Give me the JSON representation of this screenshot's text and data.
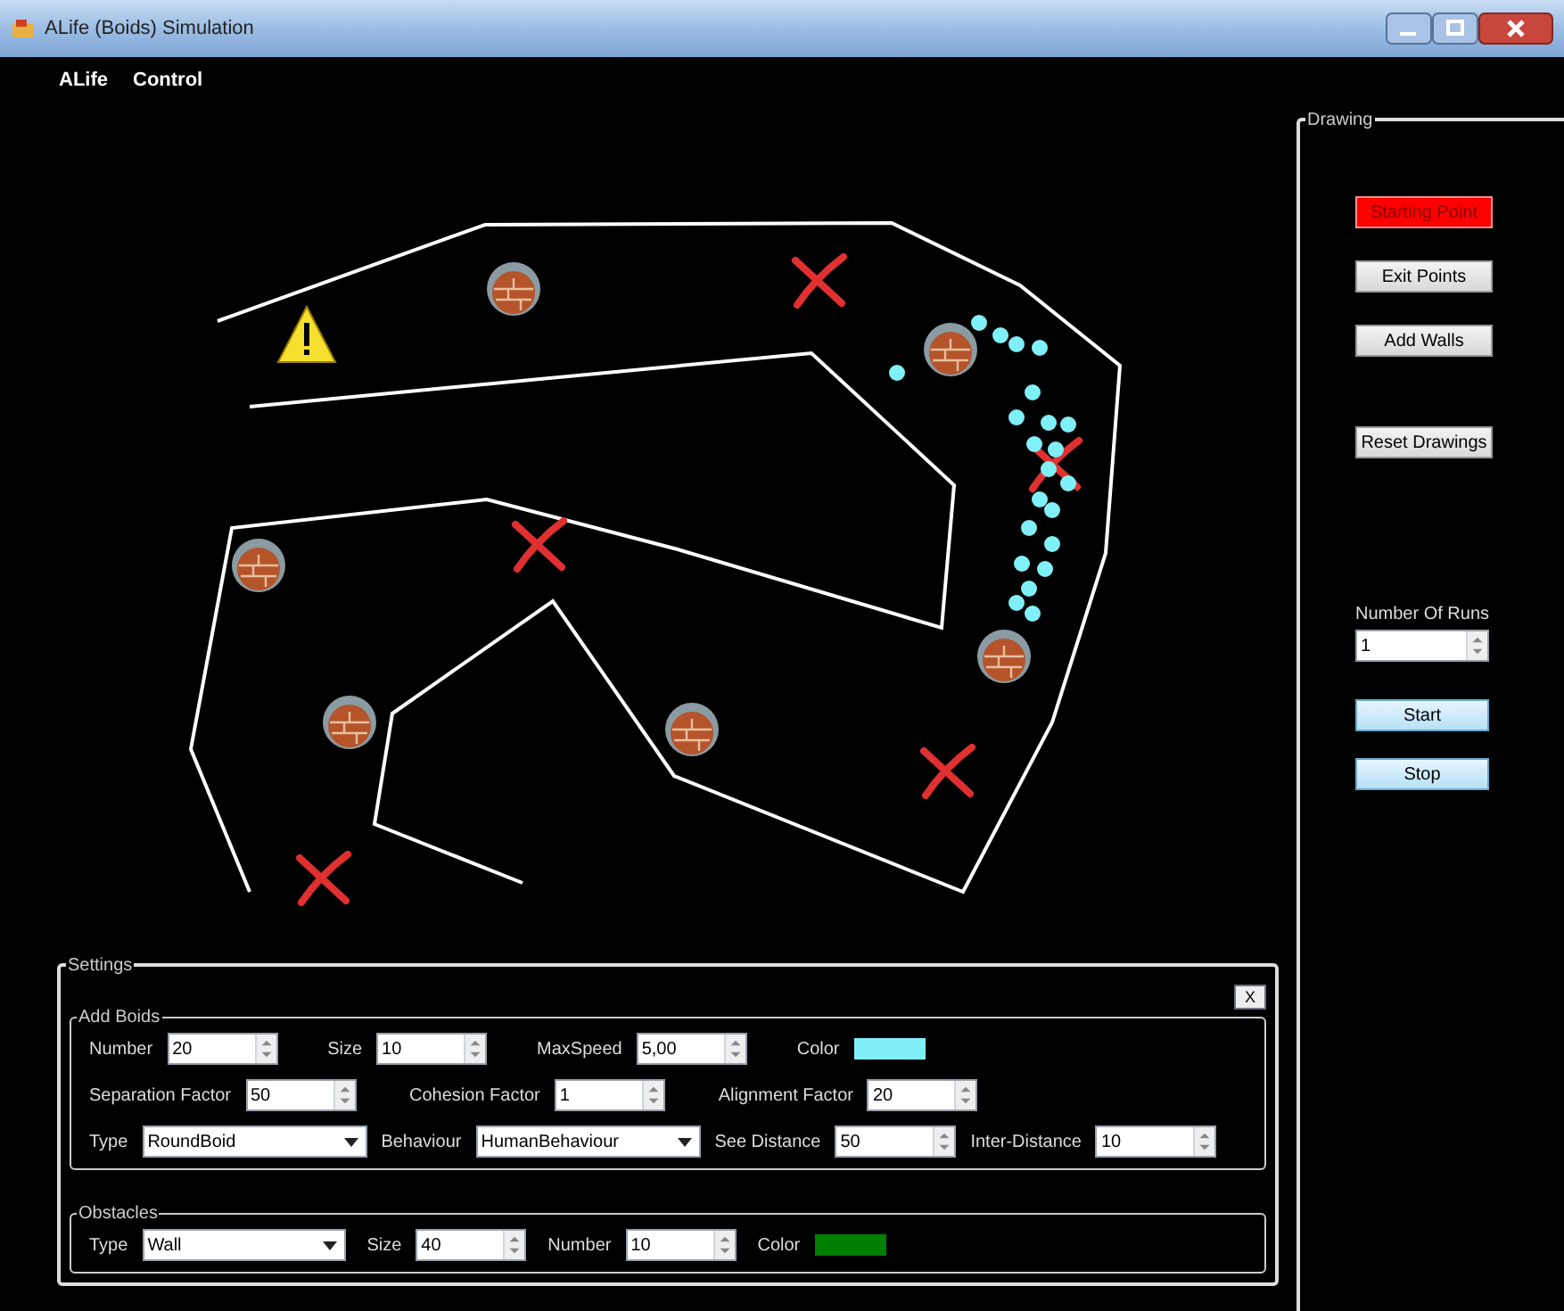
{
  "window": {
    "title": "ALife (Boids) Simulation"
  },
  "menu": [
    {
      "label": "ALife"
    },
    {
      "label": "Control"
    }
  ],
  "drawing": {
    "title": "Drawing",
    "buttons": [
      {
        "label": "Starting Point",
        "selected": true
      },
      {
        "label": "Exit Points",
        "selected": false
      },
      {
        "label": "Add Walls",
        "selected": false
      },
      {
        "label": "Reset Drawings",
        "selected": false
      }
    ],
    "runs": {
      "label": "Number Of Runs",
      "value": "1"
    },
    "run_buttons": [
      {
        "label": "Start"
      },
      {
        "label": "Stop"
      }
    ]
  },
  "settings": {
    "title": "Settings",
    "close": "X",
    "add_boids": {
      "title": "Add Boids",
      "lines": [
        {
          "fields": [
            {
              "kind": "spinner",
              "label": "Number",
              "value": "20"
            },
            {
              "kind": "spinner",
              "label": "Size",
              "value": "10"
            },
            {
              "kind": "spinner",
              "label": "MaxSpeed",
              "value": "5,00"
            },
            {
              "kind": "color",
              "label": "Color",
              "color": "#80f0f8"
            }
          ]
        },
        {
          "fields": [
            {
              "kind": "spinner",
              "label": "Separation Factor",
              "value": "50"
            },
            {
              "kind": "spinner",
              "label": "Cohesion Factor",
              "value": "1"
            },
            {
              "kind": "spinner",
              "label": "Alignment Factor",
              "value": "20"
            }
          ]
        },
        {
          "fields": [
            {
              "kind": "dropdown",
              "label": "Type",
              "value": "RoundBoid"
            },
            {
              "kind": "dropdown",
              "label": "Behaviour",
              "value": "HumanBehaviour"
            },
            {
              "kind": "spinner",
              "label": "See Distance",
              "value": "50"
            },
            {
              "kind": "spinner",
              "label": "Inter-Distance",
              "value": "10"
            }
          ]
        }
      ]
    },
    "obstacles": {
      "title": "Obstacles",
      "lines": [
        {
          "fields": [
            {
              "kind": "dropdown",
              "label": "Type",
              "value": "Wall"
            },
            {
              "kind": "spinner",
              "label": "Size",
              "value": "40"
            },
            {
              "kind": "spinner",
              "label": "Number",
              "value": "10"
            },
            {
              "kind": "color",
              "label": "Color",
              "color": "#008000"
            }
          ]
        }
      ]
    }
  }
}
